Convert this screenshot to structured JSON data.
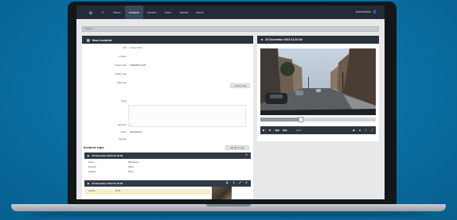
{
  "nav": {
    "items": [
      {
        "label": "Videos",
        "active": false
      },
      {
        "label": "Incidents",
        "active": true
      },
      {
        "label": "Devices",
        "active": false
      },
      {
        "label": "Users",
        "active": false
      },
      {
        "label": "Tactical",
        "active": false
      },
      {
        "label": "Admin",
        "active": false
      }
    ],
    "user": "Administrator"
  },
  "search_bar": {
    "value": "Search"
  },
  "incident_form": {
    "title": "New incident",
    "fields": [
      {
        "label": "Title",
        "value": "Incident 2019",
        "link": true
      },
      {
        "label": "Location",
        "value": ""
      },
      {
        "label": "Incident date",
        "value": "01/09/2019 14:25"
      },
      {
        "label": "Incident type",
        "value": ""
      },
      {
        "label": "Reference",
        "value": ""
      },
      {
        "label": "Notes",
        "value": ""
      },
      {
        "label": "Retention",
        "value": "7"
      },
      {
        "label": "Owner",
        "value": "Administrator"
      },
      {
        "label": "Operator",
        "value": ""
      }
    ],
    "add_button": "Add to case"
  },
  "clips": {
    "heading": "Incident clips",
    "add_button": "Add clip to case",
    "clip1": {
      "title": "20 December 2019 11:16:00",
      "rows": [
        {
          "label": "Device",
          "value": "BWV-Device"
        },
        {
          "label": "Recorder",
          "value": "Officer"
        },
        {
          "label": "Duration",
          "value": "00:32"
        }
      ]
    },
    "clip2": {
      "title": "20 December 2019 11:16:06",
      "row": {
        "label": "Incident",
        "value": "00:45"
      }
    }
  },
  "player": {
    "title": "20 December 2019 11:16:00",
    "time": "00:12",
    "progress": 0.35
  },
  "colors": {
    "background": "#0a6fa3",
    "navbar": "#232c36",
    "panel_header": "#2a323b"
  },
  "icons": [
    "home-icon",
    "user-icon",
    "video-camera-icon",
    "document-icon",
    "plus-icon",
    "play-icon",
    "stop-icon",
    "rewind-icon",
    "forward-icon",
    "volume-icon",
    "fullscreen-icon",
    "download-icon",
    "delete-icon",
    "expand-icon"
  ]
}
